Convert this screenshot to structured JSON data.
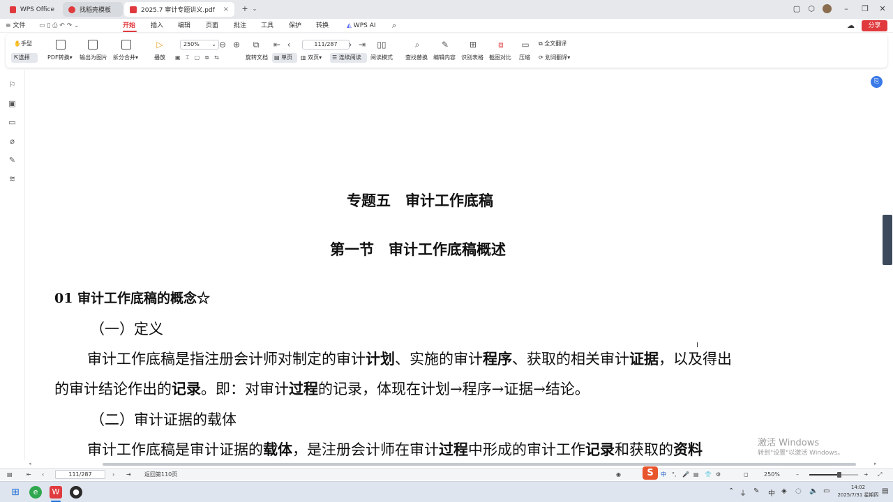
{
  "tabs": [
    {
      "label": "WPS Office",
      "color": "#e03a3e"
    },
    {
      "label": "找稻壳模板",
      "color": "#e03a3e"
    },
    {
      "label": "2025.7 审计专题讲义.pdf",
      "color": "#e03a3e"
    }
  ],
  "menu": {
    "items": [
      "文件",
      "开始",
      "插入",
      "编辑",
      "页面",
      "批注",
      "工具",
      "保护",
      "转换",
      "WPS AI"
    ],
    "active": "开始",
    "share": "分享"
  },
  "ribbon": {
    "hand": "手型",
    "select": "选择",
    "pdf_convert": "PDF转换",
    "export_image": "输出为图片",
    "split_merge": "拆分合并",
    "play": "播放",
    "zoom": "250%",
    "page": "111/287",
    "rotate": "旋转文档",
    "single": "单页",
    "double": "双页",
    "continuous": "连续阅读",
    "read_mode": "阅读模式",
    "find_replace": "查找替换",
    "edit_content": "编辑内容",
    "recognize_table": "识别表格",
    "screenshot_compare": "截图对比",
    "compress": "压缩",
    "full_translate": "全文翻译",
    "word_translate": "划词翻译"
  },
  "document": {
    "title": "专题五　审计工作底稿",
    "section": "第一节　审计工作底稿概述",
    "heading": "01 审计工作底稿的概念☆",
    "sub1": "（一）定义",
    "p1_parts": [
      "审计工作底稿是指注册会计师对制定的审计",
      "计划",
      "、实施的审计",
      "程序",
      "、获取的相关审计",
      "证据",
      "，以及得出"
    ],
    "p2_parts": [
      "的审计结论作出的",
      "记录",
      "。即：对审计",
      "过程",
      "的记录，体现在计划→程序→证据→结论。"
    ],
    "sub2": "（二）审计证据的载体",
    "p3_parts": [
      "审计工作底稿是审计证据的",
      "载体",
      "，是注册会计师在审计",
      "过程",
      "中形成的审计工作",
      "记录",
      "和获取的",
      "资料"
    ]
  },
  "status": {
    "page": "111/287",
    "goto": "返回第110页",
    "zoom": "250%",
    "zoom_fraction": 0.62
  },
  "watermark": {
    "line1": "激活 Windows",
    "line2": "转到\"设置\"以激活 Windows。"
  },
  "ime": [
    "中",
    "°,",
    "🎤",
    "▤",
    "👕",
    "⚙"
  ],
  "tray_ime": "中",
  "clock": {
    "time": "14:02",
    "date": "2025/7/31 星期四"
  }
}
